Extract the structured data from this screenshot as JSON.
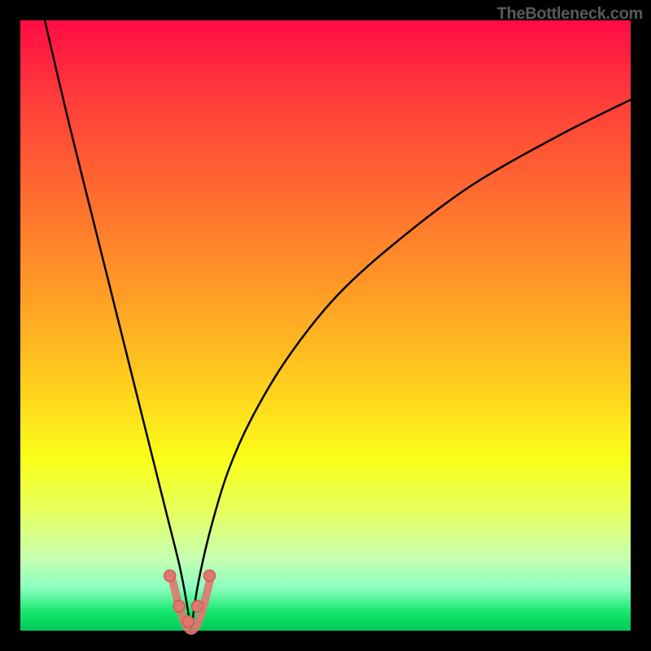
{
  "watermark": "TheBottleneck.com",
  "colors": {
    "background": "#000000",
    "gradient_top": "#ff0b45",
    "gradient_bottom": "#00c95a",
    "curve": "#000000",
    "marker": "#e0786f"
  },
  "chart_data": {
    "type": "line",
    "title": "",
    "xlabel": "",
    "ylabel": "",
    "xlim": [
      0,
      100
    ],
    "ylim": [
      0,
      100
    ],
    "notch_x": 28,
    "curves": [
      {
        "name": "left",
        "x": [
          4,
          8,
          12,
          16,
          20,
          22,
          24,
          26,
          27,
          28
        ],
        "y": [
          100,
          83,
          67,
          51,
          35,
          27,
          19,
          11,
          6,
          0
        ]
      },
      {
        "name": "right",
        "x": [
          28,
          29,
          31,
          34,
          38,
          44,
          52,
          62,
          74,
          88,
          100
        ],
        "y": [
          0,
          7,
          16,
          26,
          35,
          45,
          55,
          64,
          73,
          81,
          87
        ]
      }
    ],
    "notch_band": {
      "x": [
        25,
        26,
        27,
        28,
        29,
        30,
        31
      ],
      "y": [
        8,
        4,
        1,
        0,
        1,
        4,
        8
      ]
    },
    "markers": {
      "x": [
        24.5,
        26,
        27.5,
        29,
        31
      ],
      "y": [
        9,
        4,
        1.5,
        4,
        9
      ]
    }
  }
}
